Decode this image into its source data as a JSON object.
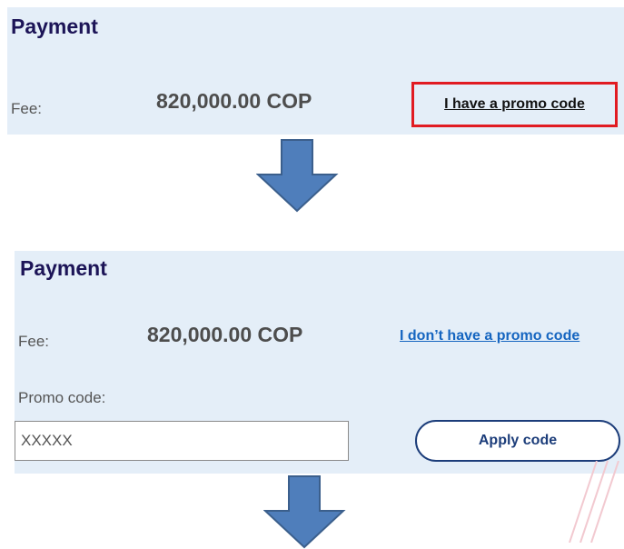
{
  "step1": {
    "title": "Payment",
    "fee_label": "Fee:",
    "fee_amount": "820,000.00 COP",
    "promo_link": "I have a promo code"
  },
  "step2": {
    "title": "Payment",
    "fee_label": "Fee:",
    "fee_amount": "820,000.00 COP",
    "promo_link": "I don’t have a promo code",
    "promo_label": "Promo code:",
    "promo_input_value": "XXXXX",
    "apply_button": "Apply code"
  },
  "colors": {
    "panel_bg": "#e4eef8",
    "title": "#1c1457",
    "highlight_border": "#e11b22",
    "link_blue": "#1565c0",
    "arrow_fill": "#4f7ebb",
    "arrow_stroke": "#3b5f8c"
  },
  "icons": {
    "arrow": "arrow-down-icon"
  }
}
